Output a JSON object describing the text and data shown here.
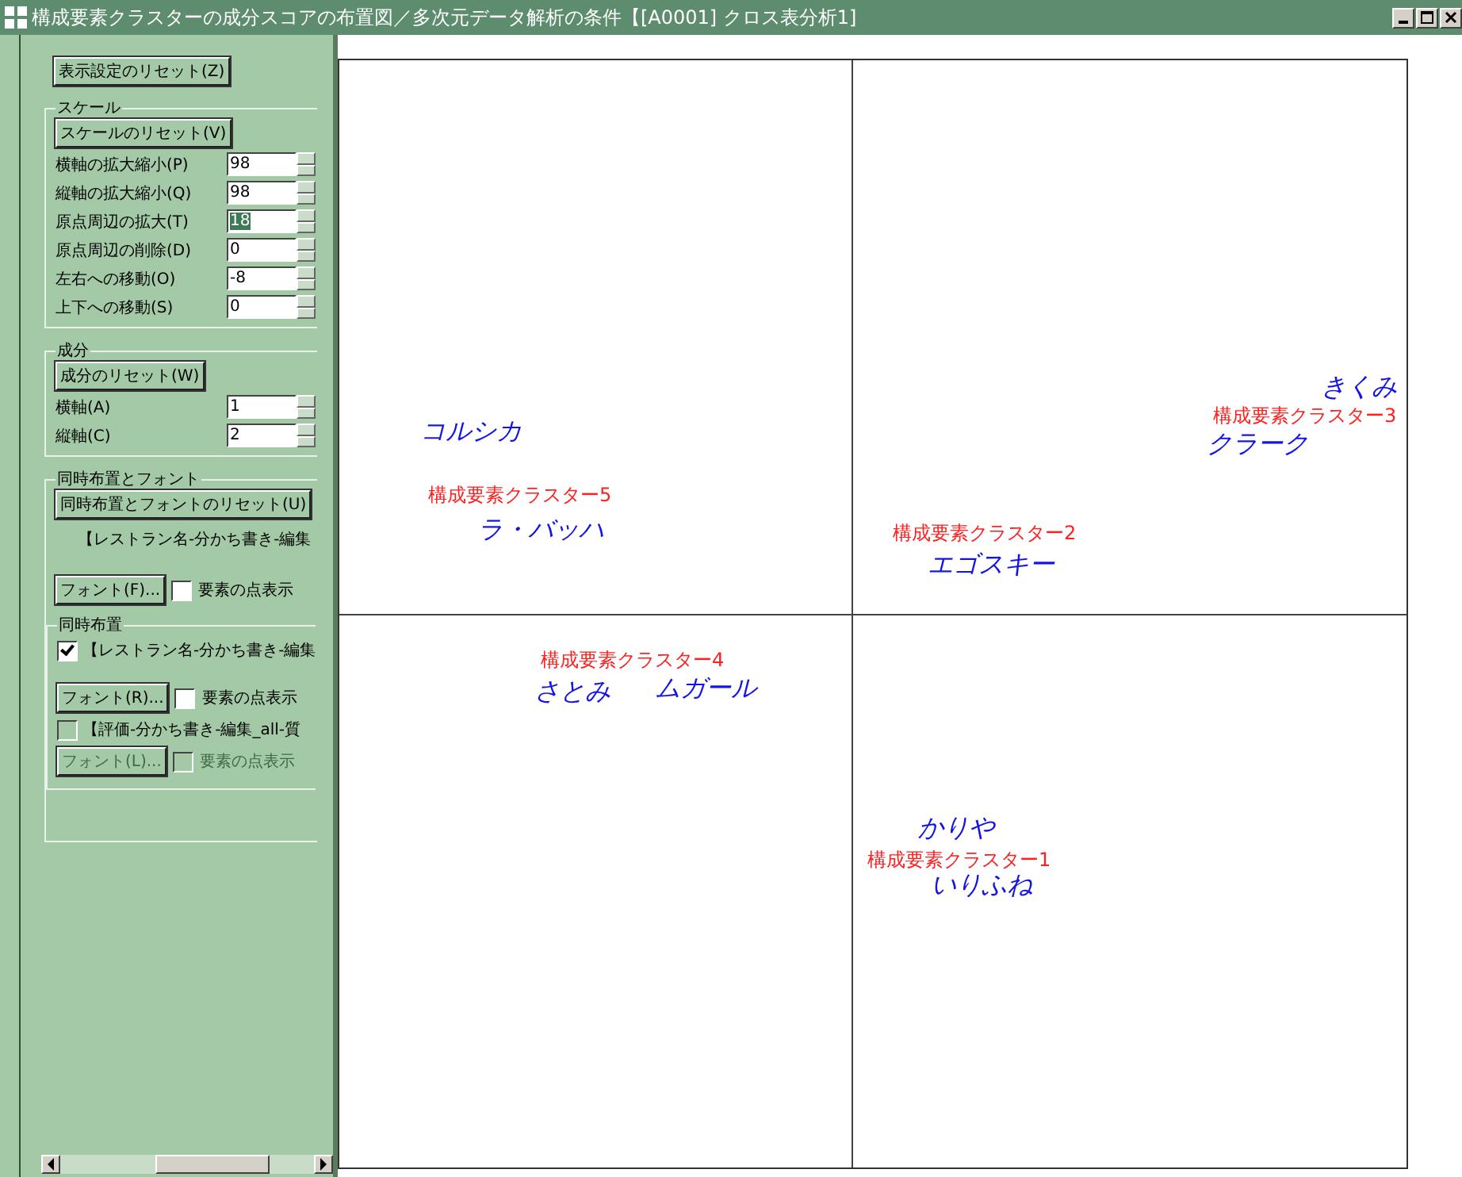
{
  "window": {
    "title": "構成要素クラスターの成分スコアの布置図／多次元データ解析の条件【[A0001] クロス表分析1]"
  },
  "panel": {
    "reset_button": "表示設定のリセット(Z)",
    "scale": {
      "legend": "スケール",
      "reset_button": "スケールのリセット(V)",
      "fields": [
        {
          "label": "横軸の拡大縮小(P)",
          "value": "98",
          "selected": false
        },
        {
          "label": "縦軸の拡大縮小(Q)",
          "value": "98",
          "selected": false
        },
        {
          "label": "原点周辺の拡大(T)",
          "value": "18",
          "selected": true
        },
        {
          "label": "原点周辺の削除(D)",
          "value": "0",
          "selected": false
        },
        {
          "label": "左右への移動(O)",
          "value": "-8",
          "selected": false
        },
        {
          "label": "上下への移動(S)",
          "value": "0",
          "selected": false
        }
      ]
    },
    "component": {
      "legend": "成分",
      "reset_button": "成分のリセット(W)",
      "fields": [
        {
          "label": "横軸(A)",
          "value": "1",
          "selected": false
        },
        {
          "label": "縦軸(C)",
          "value": "2",
          "selected": false
        }
      ]
    },
    "layout": {
      "legend": "同時布置とフォント",
      "reset_button": "同時布置とフォントのリセット(U)",
      "primary": {
        "label": "【レストラン名-分かち書き-編集",
        "font_button": "フォント(F)...",
        "points_label": "要素の点表示",
        "points_checked": false
      },
      "overlay": {
        "legend": "同時布置",
        "items": [
          {
            "label": "【レストラン名-分かち書き-編集",
            "checked": true,
            "disabled": false,
            "font_button": "フォント(R)...",
            "points_label": "要素の点表示",
            "points_checked": false
          },
          {
            "label": "【評価-分かち書き-編集_all-質",
            "checked": false,
            "disabled": true,
            "font_button": "フォント(L)...",
            "points_label": "要素の点表示",
            "points_checked": false
          }
        ]
      }
    }
  },
  "plot": {
    "labels": [
      {
        "text": "コルシカ",
        "kind": "element"
      },
      {
        "text": "構成要素クラスター5",
        "kind": "cluster"
      },
      {
        "text": "ラ・バッハ",
        "kind": "element"
      },
      {
        "text": "構成要素クラスター2",
        "kind": "cluster"
      },
      {
        "text": "エゴスキー",
        "kind": "element"
      },
      {
        "text": "きくみ",
        "kind": "element"
      },
      {
        "text": "構成要素クラスター3",
        "kind": "cluster"
      },
      {
        "text": "クラーク",
        "kind": "element"
      },
      {
        "text": "構成要素クラスター4",
        "kind": "cluster"
      },
      {
        "text": "さとみ",
        "kind": "element"
      },
      {
        "text": "ムガール",
        "kind": "element"
      },
      {
        "text": "かりや",
        "kind": "element"
      },
      {
        "text": "構成要素クラスター1",
        "kind": "cluster"
      },
      {
        "text": "いりふね",
        "kind": "element"
      }
    ]
  }
}
